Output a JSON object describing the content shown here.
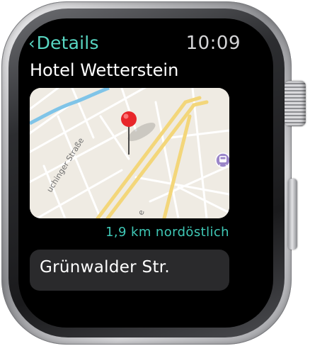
{
  "nav": {
    "back_label": "Details",
    "back_chevron": "‹",
    "time": "10:09"
  },
  "place": {
    "name": "Hotel Wetterstein"
  },
  "map": {
    "street_labels": [
      "uchinger Straße",
      "e"
    ],
    "pin_icon": "map-pin-icon",
    "transit_icon": "train-icon",
    "colors": {
      "land": "#efebe3",
      "minor_road": "#ffffff",
      "major_road": "#f3d67a",
      "water": "#7fc4e8",
      "pin": "#e8262a",
      "transit_badge": "#9b86c9"
    }
  },
  "distance": "1,9 km nordöstlich",
  "address": "Grünwalder Str.",
  "colors": {
    "accent": "#58d6c2",
    "screen": "#000000",
    "cell": "#2a2a2c"
  }
}
